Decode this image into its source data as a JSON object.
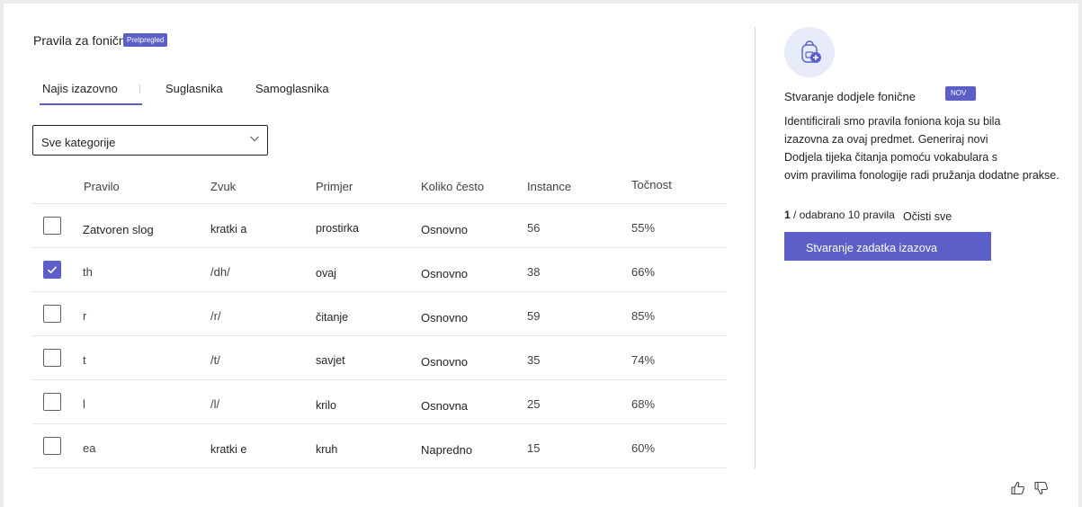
{
  "header": {
    "title": "Pravila za fonični",
    "preview_badge": "Pretpregled"
  },
  "tabs": [
    {
      "label": "Najis izazovno",
      "active": true
    },
    {
      "label": "Suglasnika",
      "active": false
    },
    {
      "label": "Samoglasnika",
      "active": false
    }
  ],
  "filter": {
    "selected": "Sve kategorije"
  },
  "table": {
    "columns": [
      "Pravilo",
      "Zvuk",
      "Primjer",
      "Koliko često",
      "Instance",
      "Točnost"
    ],
    "rows": [
      {
        "checked": false,
        "rule": "Zatvoren slog",
        "sound": "kratki a",
        "example": "prostirka",
        "frequency": "Osnovno",
        "instances": "56",
        "accuracy": "55%"
      },
      {
        "checked": true,
        "rule": "th",
        "sound": "/dh/",
        "example": "ovaj",
        "frequency": "Osnovno",
        "instances": "38",
        "accuracy": "66%"
      },
      {
        "checked": false,
        "rule": "r",
        "sound": "/r/",
        "example": "čitanje",
        "frequency": "Osnovno",
        "instances": "59",
        "accuracy": "85%"
      },
      {
        "checked": false,
        "rule": "t",
        "sound": "/t/",
        "example": "savjet",
        "frequency": "Osnovno",
        "instances": "35",
        "accuracy": "74%"
      },
      {
        "checked": false,
        "rule": "l",
        "sound": "/l/",
        "example": "krilo",
        "frequency": "Osnovna",
        "instances": "25",
        "accuracy": "68%"
      },
      {
        "checked": false,
        "rule": "ea",
        "sound": "kratki e",
        "example": "kruh",
        "frequency": "Napredno",
        "instances": "15",
        "accuracy": "60%"
      }
    ]
  },
  "panel": {
    "icon": "backpack-add-icon",
    "title": "Stvaranje dodjele fonične",
    "new_badge": "NOV",
    "description": [
      "Identificirali smo pravila foniona koja su bila",
      "izazovna za ovaj predmet. Generiraj novi",
      "Dodjela tijeka čitanja pomoću vokabulara s",
      "ovim pravilima fonologije radi pružanja dodatne prakse."
    ],
    "count_selected": "1",
    "count_text": "/ odabrano 10 pravila",
    "clear_label": "Očisti sve",
    "create_label": "Stvaranje zadatka izazova"
  },
  "feedback": {
    "like_icon": "thumbs-up-icon",
    "dislike_icon": "thumbs-down-icon"
  },
  "colors": {
    "accent": "#5b5fc7"
  }
}
